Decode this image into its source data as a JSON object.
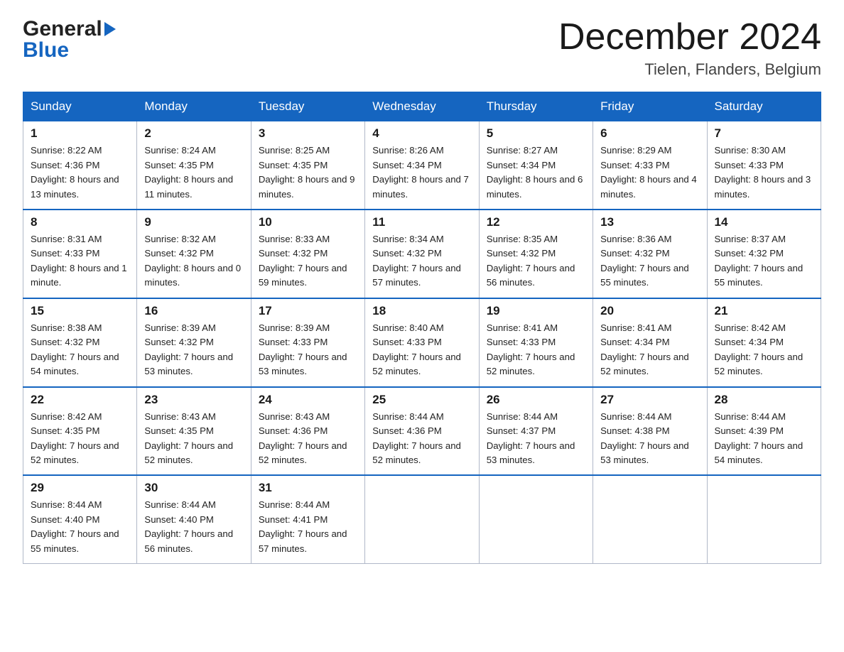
{
  "header": {
    "logo_general": "General",
    "logo_blue": "Blue",
    "month_title": "December 2024",
    "location": "Tielen, Flanders, Belgium"
  },
  "weekdays": [
    "Sunday",
    "Monday",
    "Tuesday",
    "Wednesday",
    "Thursday",
    "Friday",
    "Saturday"
  ],
  "weeks": [
    [
      {
        "day": "1",
        "sunrise": "8:22 AM",
        "sunset": "4:36 PM",
        "daylight": "8 hours and 13 minutes."
      },
      {
        "day": "2",
        "sunrise": "8:24 AM",
        "sunset": "4:35 PM",
        "daylight": "8 hours and 11 minutes."
      },
      {
        "day": "3",
        "sunrise": "8:25 AM",
        "sunset": "4:35 PM",
        "daylight": "8 hours and 9 minutes."
      },
      {
        "day": "4",
        "sunrise": "8:26 AM",
        "sunset": "4:34 PM",
        "daylight": "8 hours and 7 minutes."
      },
      {
        "day": "5",
        "sunrise": "8:27 AM",
        "sunset": "4:34 PM",
        "daylight": "8 hours and 6 minutes."
      },
      {
        "day": "6",
        "sunrise": "8:29 AM",
        "sunset": "4:33 PM",
        "daylight": "8 hours and 4 minutes."
      },
      {
        "day": "7",
        "sunrise": "8:30 AM",
        "sunset": "4:33 PM",
        "daylight": "8 hours and 3 minutes."
      }
    ],
    [
      {
        "day": "8",
        "sunrise": "8:31 AM",
        "sunset": "4:33 PM",
        "daylight": "8 hours and 1 minute."
      },
      {
        "day": "9",
        "sunrise": "8:32 AM",
        "sunset": "4:32 PM",
        "daylight": "8 hours and 0 minutes."
      },
      {
        "day": "10",
        "sunrise": "8:33 AM",
        "sunset": "4:32 PM",
        "daylight": "7 hours and 59 minutes."
      },
      {
        "day": "11",
        "sunrise": "8:34 AM",
        "sunset": "4:32 PM",
        "daylight": "7 hours and 57 minutes."
      },
      {
        "day": "12",
        "sunrise": "8:35 AM",
        "sunset": "4:32 PM",
        "daylight": "7 hours and 56 minutes."
      },
      {
        "day": "13",
        "sunrise": "8:36 AM",
        "sunset": "4:32 PM",
        "daylight": "7 hours and 55 minutes."
      },
      {
        "day": "14",
        "sunrise": "8:37 AM",
        "sunset": "4:32 PM",
        "daylight": "7 hours and 55 minutes."
      }
    ],
    [
      {
        "day": "15",
        "sunrise": "8:38 AM",
        "sunset": "4:32 PM",
        "daylight": "7 hours and 54 minutes."
      },
      {
        "day": "16",
        "sunrise": "8:39 AM",
        "sunset": "4:32 PM",
        "daylight": "7 hours and 53 minutes."
      },
      {
        "day": "17",
        "sunrise": "8:39 AM",
        "sunset": "4:33 PM",
        "daylight": "7 hours and 53 minutes."
      },
      {
        "day": "18",
        "sunrise": "8:40 AM",
        "sunset": "4:33 PM",
        "daylight": "7 hours and 52 minutes."
      },
      {
        "day": "19",
        "sunrise": "8:41 AM",
        "sunset": "4:33 PM",
        "daylight": "7 hours and 52 minutes."
      },
      {
        "day": "20",
        "sunrise": "8:41 AM",
        "sunset": "4:34 PM",
        "daylight": "7 hours and 52 minutes."
      },
      {
        "day": "21",
        "sunrise": "8:42 AM",
        "sunset": "4:34 PM",
        "daylight": "7 hours and 52 minutes."
      }
    ],
    [
      {
        "day": "22",
        "sunrise": "8:42 AM",
        "sunset": "4:35 PM",
        "daylight": "7 hours and 52 minutes."
      },
      {
        "day": "23",
        "sunrise": "8:43 AM",
        "sunset": "4:35 PM",
        "daylight": "7 hours and 52 minutes."
      },
      {
        "day": "24",
        "sunrise": "8:43 AM",
        "sunset": "4:36 PM",
        "daylight": "7 hours and 52 minutes."
      },
      {
        "day": "25",
        "sunrise": "8:44 AM",
        "sunset": "4:36 PM",
        "daylight": "7 hours and 52 minutes."
      },
      {
        "day": "26",
        "sunrise": "8:44 AM",
        "sunset": "4:37 PM",
        "daylight": "7 hours and 53 minutes."
      },
      {
        "day": "27",
        "sunrise": "8:44 AM",
        "sunset": "4:38 PM",
        "daylight": "7 hours and 53 minutes."
      },
      {
        "day": "28",
        "sunrise": "8:44 AM",
        "sunset": "4:39 PM",
        "daylight": "7 hours and 54 minutes."
      }
    ],
    [
      {
        "day": "29",
        "sunrise": "8:44 AM",
        "sunset": "4:40 PM",
        "daylight": "7 hours and 55 minutes."
      },
      {
        "day": "30",
        "sunrise": "8:44 AM",
        "sunset": "4:40 PM",
        "daylight": "7 hours and 56 minutes."
      },
      {
        "day": "31",
        "sunrise": "8:44 AM",
        "sunset": "4:41 PM",
        "daylight": "7 hours and 57 minutes."
      },
      null,
      null,
      null,
      null
    ]
  ]
}
